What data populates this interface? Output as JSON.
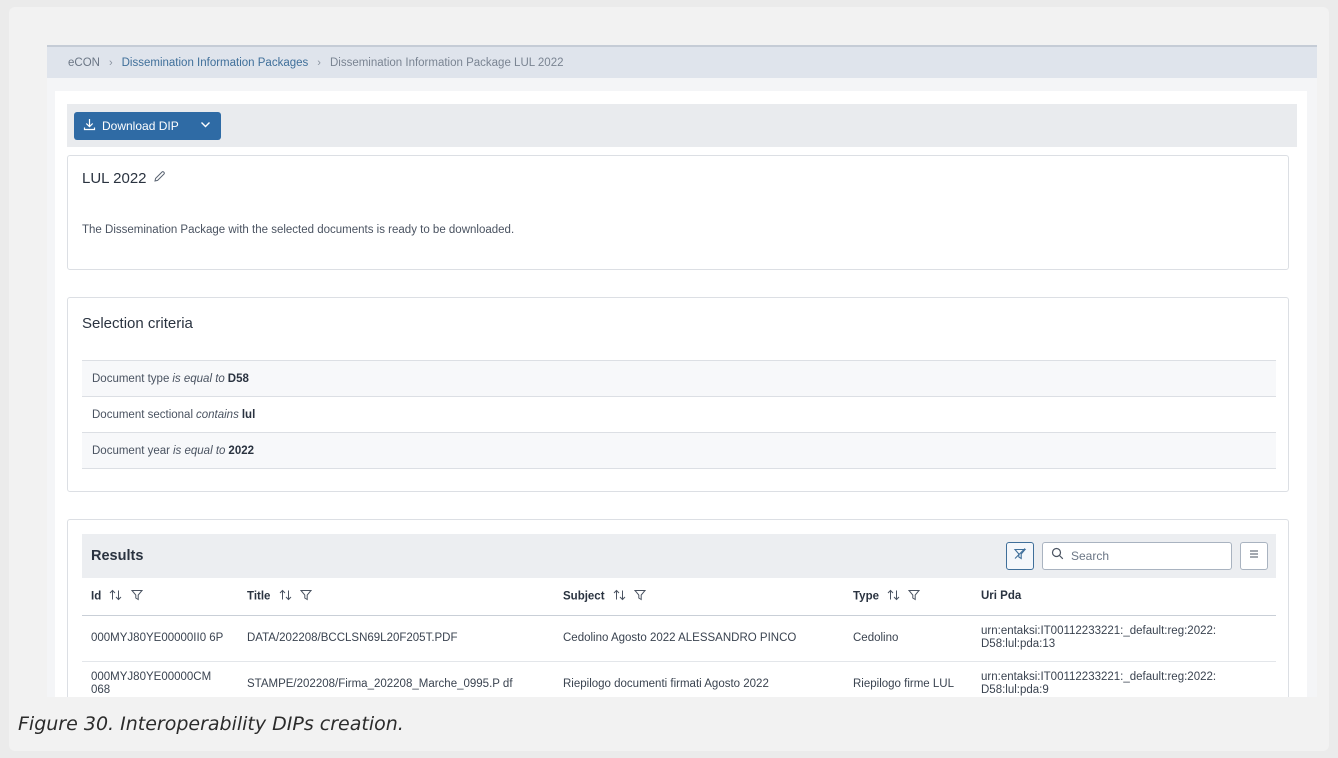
{
  "breadcrumb": {
    "items": [
      "eCON",
      "Dissemination Information Packages",
      "Dissemination Information Package LUL 2022"
    ]
  },
  "toolbar": {
    "download_label": "Download DIP"
  },
  "dip": {
    "title": "LUL 2022",
    "message": "The Dissemination Package with the selected documents is ready to be downloaded."
  },
  "criteria": {
    "title": "Selection criteria",
    "rows": [
      {
        "field": "Document type",
        "operator": "is equal to",
        "value": "D58"
      },
      {
        "field": "Document sectional",
        "operator": "contains",
        "value": "lul"
      },
      {
        "field": "Document year",
        "operator": "is equal to",
        "value": "2022"
      }
    ]
  },
  "results": {
    "title": "Results",
    "search_placeholder": "Search",
    "columns": [
      "Id",
      "Title",
      "Subject",
      "Type",
      "Uri Pda"
    ],
    "rows": [
      {
        "id": "000MYJ80YE00000II0 6P",
        "title": "DATA/202208/BCCLSN69L20F205T.PDF",
        "subject": "Cedolino Agosto 2022 ALESSANDRO PINCO",
        "type": "Cedolino",
        "uri": "urn:entaksi:IT00112233221:_default:reg:2022: D58:lul:pda:13"
      },
      {
        "id": "000MYJ80YE00000CM 068",
        "title": "STAMPE/202208/Firma_202208_Marche_0995.P df",
        "subject": "Riepilogo documenti firmati Agosto 2022",
        "type": "Riepilogo firme LUL",
        "uri": "urn:entaksi:IT00112233221:_default:reg:2022: D58:lul:pda:9"
      }
    ]
  },
  "caption": "Figure 30. Interoperability DIPs creation."
}
